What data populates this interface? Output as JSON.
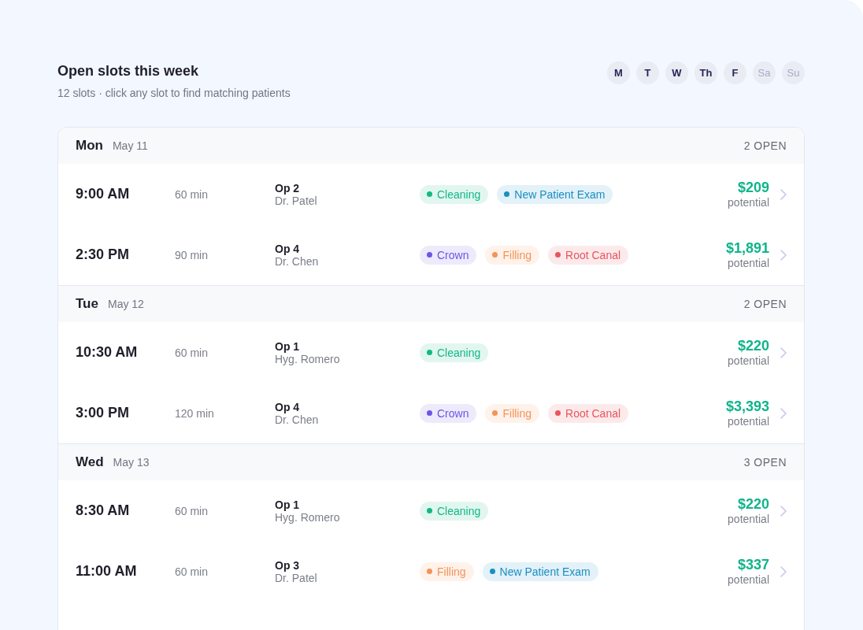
{
  "header": {
    "title": "Open slots this week",
    "subtitle": "12 slots · click any slot to find matching patients"
  },
  "day_filters": [
    {
      "label": "M",
      "enabled": true
    },
    {
      "label": "T",
      "enabled": true
    },
    {
      "label": "W",
      "enabled": true
    },
    {
      "label": "Th",
      "enabled": true
    },
    {
      "label": "F",
      "enabled": true
    },
    {
      "label": "Sa",
      "enabled": false
    },
    {
      "label": "Su",
      "enabled": false
    }
  ],
  "days": [
    {
      "day": "Mon",
      "date": "May 11",
      "open_count": "2 OPEN",
      "slots": [
        {
          "time": "9:00 AM",
          "duration": "60 min",
          "room": "Op 2",
          "provider": "Dr. Patel",
          "tags": [
            {
              "label": "Cleaning",
              "color": "#12b886"
            },
            {
              "label": "New Patient Exam",
              "color": "#1a8fc2"
            }
          ],
          "amount": "$209",
          "amount_label": "potential"
        },
        {
          "time": "2:30 PM",
          "duration": "90 min",
          "room": "Op 4",
          "provider": "Dr. Chen",
          "tags": [
            {
              "label": "Crown",
              "color": "#6c55e6"
            },
            {
              "label": "Filling",
              "color": "#f39458"
            },
            {
              "label": "Root Canal",
              "color": "#e9545e"
            }
          ],
          "amount": "$1,891",
          "amount_label": "potential"
        }
      ]
    },
    {
      "day": "Tue",
      "date": "May 12",
      "open_count": "2 OPEN",
      "slots": [
        {
          "time": "10:30 AM",
          "duration": "60 min",
          "room": "Op 1",
          "provider": "Hyg. Romero",
          "tags": [
            {
              "label": "Cleaning",
              "color": "#12b886"
            }
          ],
          "amount": "$220",
          "amount_label": "potential"
        },
        {
          "time": "3:00 PM",
          "duration": "120 min",
          "room": "Op 4",
          "provider": "Dr. Chen",
          "tags": [
            {
              "label": "Crown",
              "color": "#6c55e6"
            },
            {
              "label": "Filling",
              "color": "#f39458"
            },
            {
              "label": "Root Canal",
              "color": "#e9545e"
            }
          ],
          "amount": "$3,393",
          "amount_label": "potential"
        }
      ]
    },
    {
      "day": "Wed",
      "date": "May 13",
      "open_count": "3 OPEN",
      "slots": [
        {
          "time": "8:30 AM",
          "duration": "60 min",
          "room": "Op 1",
          "provider": "Hyg. Romero",
          "tags": [
            {
              "label": "Cleaning",
              "color": "#12b886"
            }
          ],
          "amount": "$220",
          "amount_label": "potential"
        },
        {
          "time": "11:00 AM",
          "duration": "60 min",
          "room": "Op 3",
          "provider": "Dr. Patel",
          "tags": [
            {
              "label": "Filling",
              "color": "#f39458"
            },
            {
              "label": "New Patient Exam",
              "color": "#1a8fc2"
            }
          ],
          "amount": "$337",
          "amount_label": "potential"
        }
      ]
    }
  ]
}
